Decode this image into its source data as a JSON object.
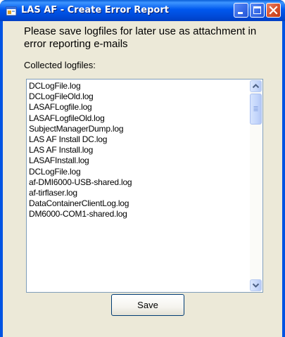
{
  "window": {
    "title": "LAS AF - Create Error Report",
    "icon": "app-window-icon",
    "controls": {
      "minimize_icon": "minimize-icon",
      "maximize_icon": "maximize-icon",
      "close_icon": "close-icon"
    },
    "colors": {
      "titlebar": "#0058ee",
      "close_button": "#d8542f",
      "dialog_background": "#ece9d8"
    }
  },
  "dialog": {
    "instructions": "Please save logfiles for later use as attachment in error reporting e-mails",
    "collected_label": "Collected logfiles:",
    "logfiles": [
      "DCLogFile.log",
      "DCLogFileOld.log",
      "LASAFLogfile.log",
      "LASAFLogfileOld.log",
      "SubjectManagerDump.log",
      "LAS AF Install DC.log",
      "LAS AF Install.log",
      "LASAFInstall.log",
      "DCLogFile.log",
      "af-DMI6000-USB-shared.log",
      "af-tirflaser.log",
      "DataContainerClientLog.log",
      "DM6000-COM1-shared.log"
    ],
    "scrollbar": {
      "up_icon": "scroll-up-arrow-icon",
      "down_icon": "scroll-down-arrow-icon",
      "position": 0.0
    },
    "save_label": "Save"
  }
}
